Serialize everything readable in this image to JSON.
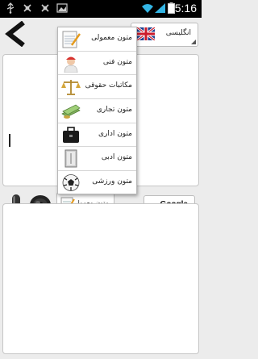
{
  "status_bar": {
    "time": "15:16",
    "icons": [
      "usb-icon",
      "debug-icon",
      "bug-icon",
      "image-icon",
      "wifi-icon",
      "signal-icon",
      "battery-icon"
    ]
  },
  "source": {
    "language_label": "انگلیسی",
    "flag": "uk-flag-icon"
  },
  "destination": {
    "type_label": "متون معمولی",
    "engine_label": "Google"
  },
  "text_type_menu": {
    "items": [
      {
        "label": "متون معمولی",
        "icon": "notepad-icon"
      },
      {
        "label": "متون فنی",
        "icon": "engineer-icon"
      },
      {
        "label": "مکاتبات حقوقی",
        "icon": "scales-icon"
      },
      {
        "label": "متون تجاری",
        "icon": "money-icon"
      },
      {
        "label": "متون اداری",
        "icon": "briefcase-icon"
      },
      {
        "label": "متون ادبی",
        "icon": "book-icon"
      },
      {
        "label": "متون ورزشی",
        "icon": "soccer-ball-icon"
      }
    ]
  },
  "colors": {
    "status_bar": "#000000",
    "background": "#ececec",
    "panel": "#ffffff",
    "border": "#c6c6c6"
  }
}
